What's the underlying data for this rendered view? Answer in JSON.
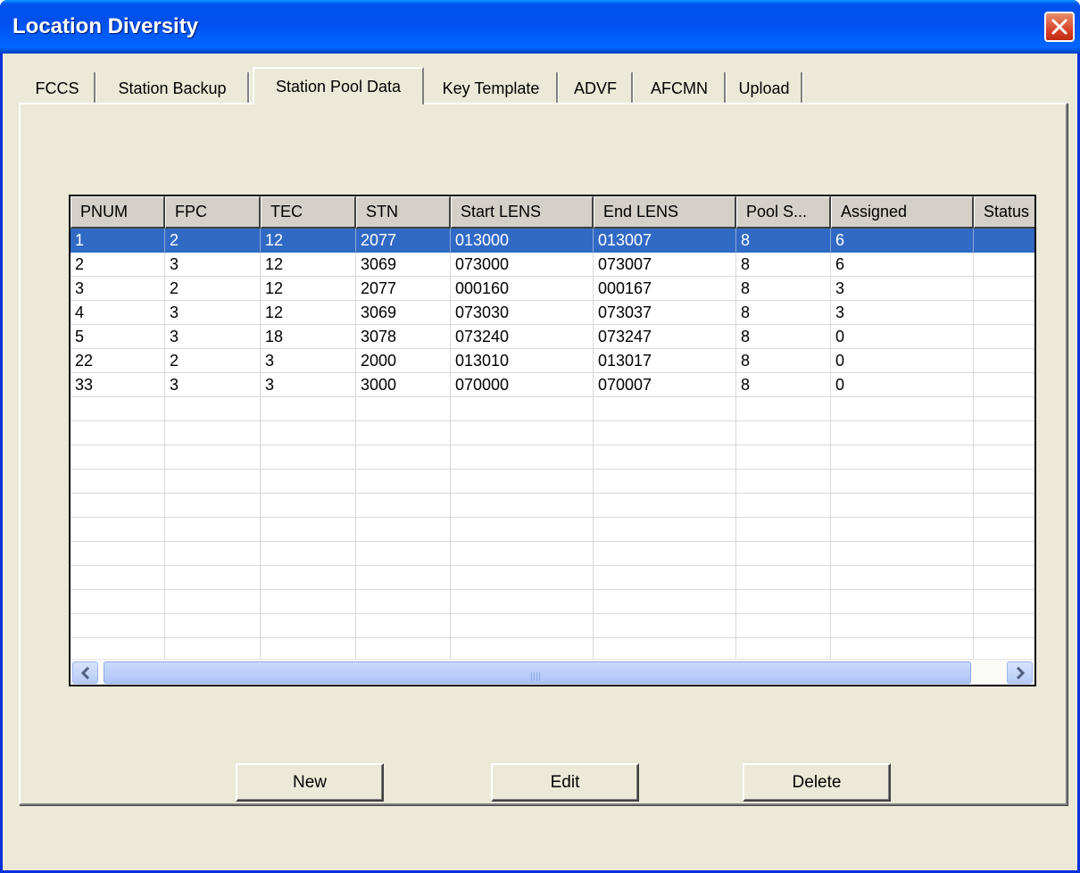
{
  "window": {
    "title": "Location Diversity"
  },
  "tabs": [
    "FCCS",
    "Station Backup",
    "Station Pool Data",
    "Key Template",
    "ADVF",
    "AFCMN",
    "Upload"
  ],
  "active_tab": "Station Pool Data",
  "table": {
    "columns": [
      "PNUM",
      "FPC",
      "TEC",
      "STN",
      "Start LENS",
      "End LENS",
      "Pool S...",
      "Assigned",
      "Status"
    ],
    "rows": [
      [
        "1",
        "2",
        "12",
        "2077",
        "013000",
        "013007",
        "8",
        "6",
        ""
      ],
      [
        "2",
        "3",
        "12",
        "3069",
        "073000",
        "073007",
        "8",
        "6",
        ""
      ],
      [
        "3",
        "2",
        "12",
        "2077",
        "000160",
        "000167",
        "8",
        "3",
        ""
      ],
      [
        "4",
        "3",
        "12",
        "3069",
        "073030",
        "073037",
        "8",
        "3",
        ""
      ],
      [
        "5",
        "3",
        "18",
        "3078",
        "073240",
        "073247",
        "8",
        "0",
        ""
      ],
      [
        "22",
        "2",
        "3",
        "2000",
        "013010",
        "013017",
        "8",
        "0",
        ""
      ],
      [
        "33",
        "3",
        "3",
        "3000",
        "070000",
        "070007",
        "8",
        "0",
        ""
      ]
    ],
    "selected_row": 0
  },
  "buttons": {
    "new": "New",
    "edit": "Edit",
    "delete": "Delete"
  },
  "icons": {
    "close": "close-icon",
    "scroll_left": "arrow-left-icon",
    "scroll_right": "arrow-right-icon",
    "scroll_grip": "grip-icon"
  },
  "colors": {
    "titlebar": "#0054e3",
    "window_bg": "#ece9d8",
    "selection": "#316ac5",
    "close_button": "#d9452a"
  }
}
